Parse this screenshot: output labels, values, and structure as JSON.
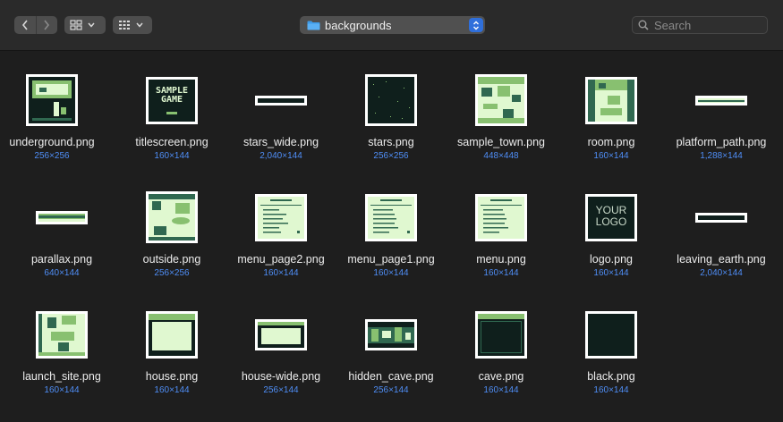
{
  "toolbar": {
    "path_label": "backgrounds",
    "search_placeholder": "Search"
  },
  "files": [
    {
      "name": "underground.png",
      "dims": "256×256"
    },
    {
      "name": "titlescreen.png",
      "dims": "160×144"
    },
    {
      "name": "stars_wide.png",
      "dims": "2,040×144"
    },
    {
      "name": "stars.png",
      "dims": "256×256"
    },
    {
      "name": "sample_town.png",
      "dims": "448×448"
    },
    {
      "name": "room.png",
      "dims": "160×144"
    },
    {
      "name": "platform_path.png",
      "dims": "1,288×144"
    },
    {
      "name": "parallax.png",
      "dims": "640×144"
    },
    {
      "name": "outside.png",
      "dims": "256×256"
    },
    {
      "name": "menu_page2.png",
      "dims": "160×144"
    },
    {
      "name": "menu_page1.png",
      "dims": "160×144"
    },
    {
      "name": "menu.png",
      "dims": "160×144"
    },
    {
      "name": "logo.png",
      "dims": "160×144"
    },
    {
      "name": "leaving_earth.png",
      "dims": "2,040×144"
    },
    {
      "name": "launch_site.png",
      "dims": "160×144"
    },
    {
      "name": "house.png",
      "dims": "160×144"
    },
    {
      "name": "house-wide.png",
      "dims": "256×144"
    },
    {
      "name": "hidden_cave.png",
      "dims": "256×144"
    },
    {
      "name": "cave.png",
      "dims": "160×144"
    },
    {
      "name": "black.png",
      "dims": "160×144"
    }
  ],
  "thumb_text": {
    "titlescreen": "SAMPLE GAME",
    "logo": "YOUR LOGO"
  },
  "colors": {
    "gb_dark": "#0f1f1c",
    "gb_mid": "#306850",
    "gb_light": "#88c070",
    "gb_pale": "#e0f8d0",
    "accent": "#2f6fdb",
    "dims_text": "#4f8ef7"
  }
}
